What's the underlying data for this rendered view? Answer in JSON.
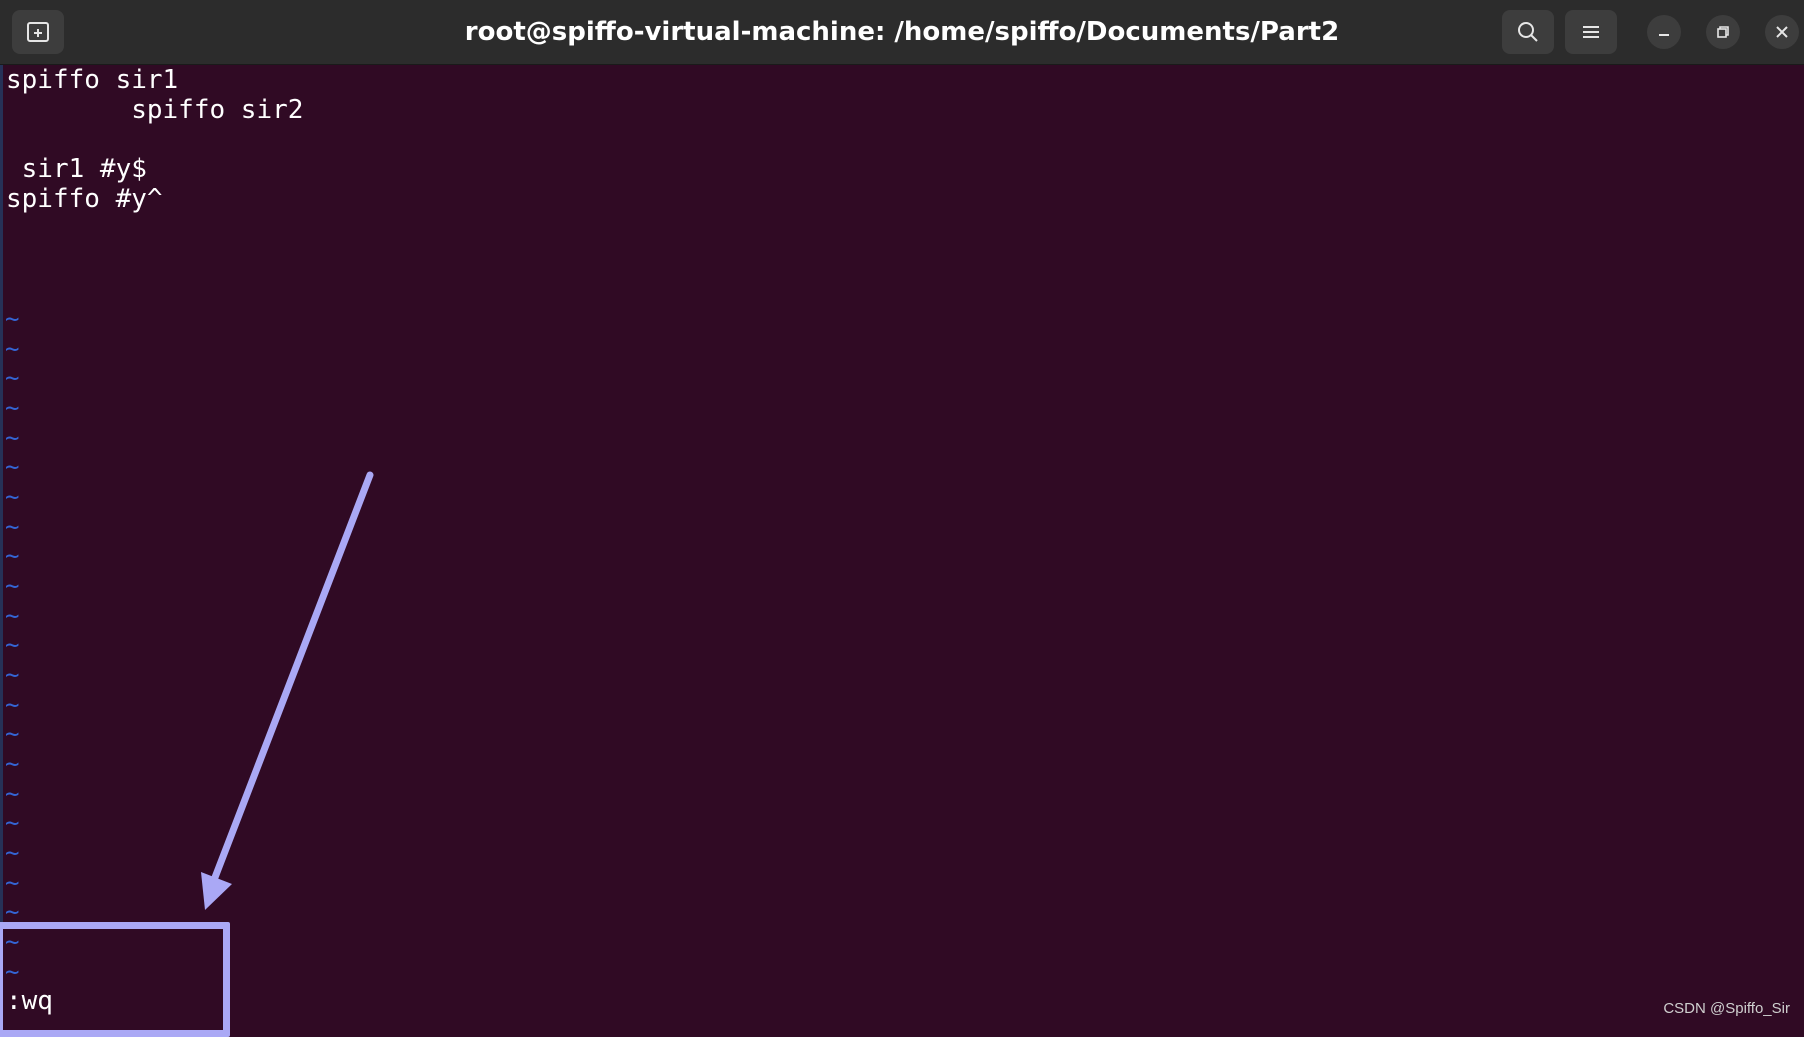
{
  "window": {
    "title": "root@spiffo-virtual-machine: /home/spiffo/Documents/Part2"
  },
  "buttons": {
    "new_tab_icon": "new-tab-icon",
    "search_icon": "search-icon",
    "menu_icon": "hamburger-menu-icon",
    "minimize_icon": "minimize-icon",
    "restore_icon": "restore-icon",
    "close_icon": "close-icon"
  },
  "editor": {
    "lines": [
      "spiffo sir1",
      "        spiffo sir2",
      "",
      " sir1 #y$",
      "spiffo #y^"
    ],
    "empty_line_marker": "~",
    "command": ":wq"
  },
  "annotation": {
    "highlight_color": "#aaa8f5"
  },
  "watermark": "CSDN @Spiffo_Sir",
  "colors": {
    "terminal_bg": "#300a24",
    "titlebar_bg": "#2c2c2c",
    "tilde": "#3465d4",
    "text": "#ffffff"
  }
}
